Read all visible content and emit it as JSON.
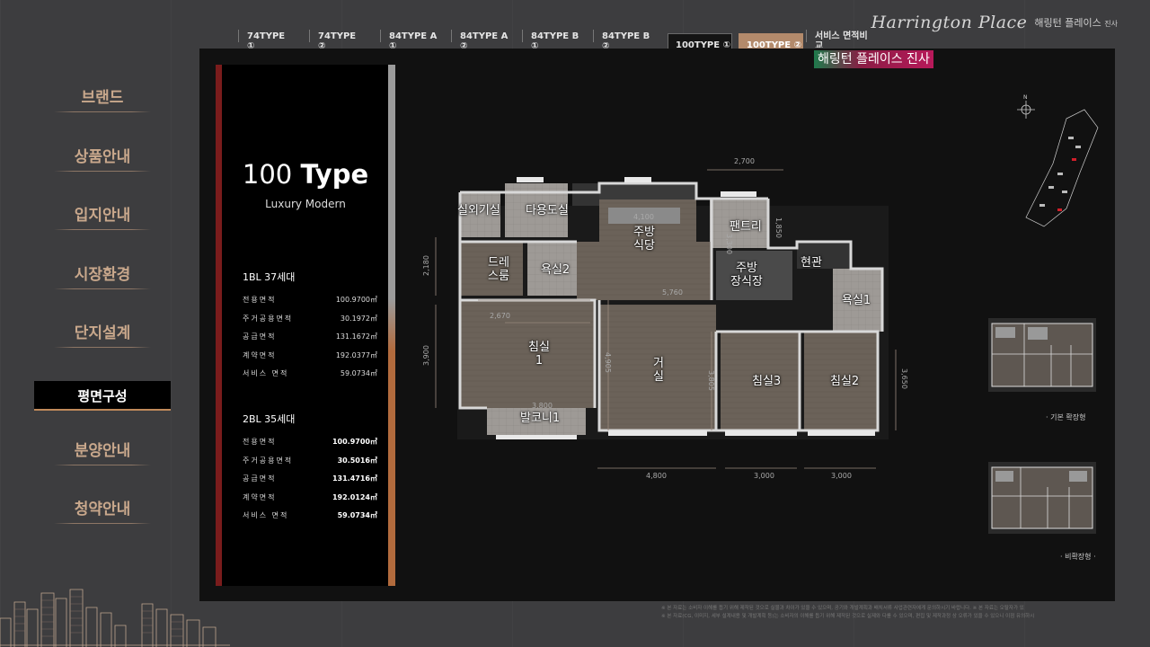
{
  "brand": {
    "script": "Harrington Place",
    "korean": "해링턴 플레이스",
    "korean_small": "진사"
  },
  "nav": {
    "items": [
      {
        "label": "브랜드"
      },
      {
        "label": "상품안내"
      },
      {
        "label": "입지안내"
      },
      {
        "label": "시장환경"
      },
      {
        "label": "단지설계"
      },
      {
        "label": "평면구성"
      },
      {
        "label": "분양안내"
      },
      {
        "label": "청약안내"
      }
    ],
    "active": "평면구성"
  },
  "tabs": [
    {
      "line1": "74TYPE",
      "line2": "①"
    },
    {
      "line1": "74TYPE",
      "line2": "②"
    },
    {
      "line1": "84TYPE A",
      "line2": "①"
    },
    {
      "line1": "84TYPE A",
      "line2": "②"
    },
    {
      "line1": "84TYPE B",
      "line2": "①"
    },
    {
      "line1": "84TYPE B",
      "line2": "②"
    },
    {
      "line1": "100TYPE ①",
      "line2": ""
    },
    {
      "line1": "100TYPE ②",
      "line2": ""
    },
    {
      "line1": "서비스 면적비",
      "line2": "교"
    }
  ],
  "caption_overlay": "해링턴 플레이스 진사",
  "info": {
    "type_number": "100",
    "type_word": "Type",
    "subtitle": "Luxury Modern",
    "block1": {
      "heading": "1BL 37세대",
      "rows": [
        {
          "label": "전용면적",
          "value": "100.9700㎡"
        },
        {
          "label": "주거공용면적",
          "value": "30.1972㎡"
        },
        {
          "label": "공급면적",
          "value": "131.1672㎡"
        },
        {
          "label": "계약면적",
          "value": "192.0377㎡"
        },
        {
          "label": "서비스 면적",
          "value": "59.0734㎡"
        }
      ]
    },
    "block2": {
      "heading": "2BL 35세대",
      "rows": [
        {
          "label": "전용면적",
          "value": "100.9700㎡"
        },
        {
          "label": "주거공용면적",
          "value": "30.5016㎡"
        },
        {
          "label": "공급면적",
          "value": "131.4716㎡"
        },
        {
          "label": "계약면적",
          "value": "192.0124㎡"
        },
        {
          "label": "서비스 면적",
          "value": "59.0734㎡"
        }
      ]
    }
  },
  "rooms": [
    {
      "label": "실외기실"
    },
    {
      "label": "다용도실"
    },
    {
      "label": "주방\n식당"
    },
    {
      "label": "팬트리"
    },
    {
      "label": "드레\n스룸"
    },
    {
      "label": "욕실2"
    },
    {
      "label": "주방\n장식장"
    },
    {
      "label": "현관"
    },
    {
      "label": "욕실1"
    },
    {
      "label": "침실\n1"
    },
    {
      "label": "거\n실"
    },
    {
      "label": "침실3"
    },
    {
      "label": "침실2"
    },
    {
      "label": "발코니1"
    }
  ],
  "dimensions": [
    "2,700",
    "4,100",
    "1,850",
    "3,300",
    "2,180",
    "5,760",
    "2,670",
    "3,900",
    "3,800",
    "4,905",
    "3,805",
    "3,650",
    "4,800",
    "3,000",
    "3,000"
  ],
  "compass": "N",
  "mini_captions": {
    "extended": "· 기본 확장형",
    "non_extended": "· 비확장형 ·"
  },
  "disclaimer": {
    "line1": "※ 본 자료는 소비자 이해를 돕기 위해 제작된 것으로 실물과 차이가 있을 수 있으며, 공기와 개발계획과 배치서류 사업관련자에게 문의하시기 바랍니다.  ※ 본 자료는 오탈자가 있",
    "line2": "※ 본 자료(CG, 이미지, 세부 설계내용 및 개발계획 등)는 소비자의 이해를 돕기 위해 제작된 것으로 실제와 다를 수 있으며, 편집 및 제작과정 상 오류가 있을 수 있으니 이점 유의하시"
  },
  "colors": {
    "accent_copper": "#b38a6b",
    "nav_text": "#c9a88c",
    "active_tab": "#b38a6b",
    "info_bar_red": "#7a1c1c"
  }
}
